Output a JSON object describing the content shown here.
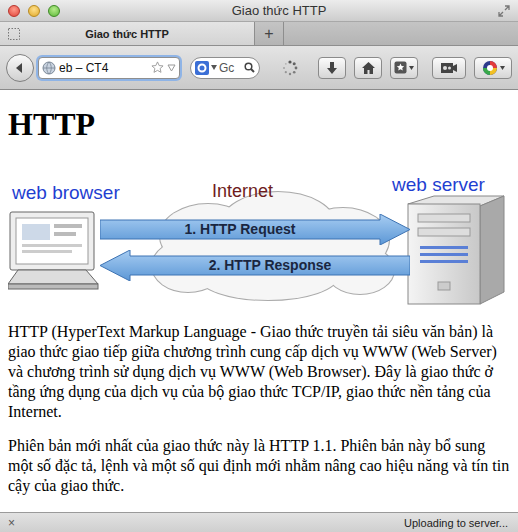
{
  "window": {
    "title": "Giao thức HTTP"
  },
  "tabs": [
    {
      "label": "Giao thức HTTP",
      "selected": true
    }
  ],
  "new_tab": "+",
  "address": {
    "text": "eb – CT4"
  },
  "search": {
    "value": "Gc"
  },
  "page": {
    "heading": "HTTP",
    "diagram": {
      "client": "web browser",
      "network": "Internet",
      "server": "web server",
      "arrows": [
        {
          "label": "1. HTTP Request",
          "direction": "right"
        },
        {
          "label": "2. HTTP Response",
          "direction": "left"
        }
      ]
    },
    "paragraphs": [
      "HTTP (HyperText Markup Language - Giao thức truyền tải siêu văn bản) là giao thức giao tiếp giữa chương trình cung cấp dịch vụ WWW (Web Server) và chương trình sử dụng dịch vụ WWW (Web Browser). Đây là giao thức ở tầng ứng dụng của dịch vụ của bộ giao thức TCP/IP, giao thức nền tảng của Internet.",
      "Phiên bản mới nhất của giao thức này là HTTP 1.1. Phiên bản này bổ sung một số đặc tả, lệnh và một số qui định mới nhằm nâng cao hiệu năng và tín tin cậy của giao thức."
    ]
  },
  "status_bar": {
    "close": "×",
    "text": "Uploading to server..."
  }
}
